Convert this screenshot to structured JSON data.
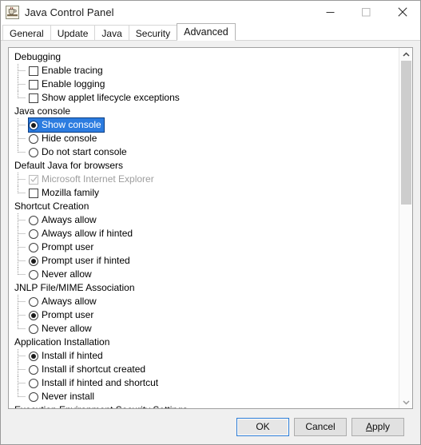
{
  "window": {
    "title": "Java Control Panel",
    "icon": "java-coffee-cup-icon",
    "controls": {
      "minimize": "minimize-icon",
      "maximize": "maximize-icon",
      "close": "close-icon"
    }
  },
  "tabs": [
    {
      "label": "General",
      "active": false
    },
    {
      "label": "Update",
      "active": false
    },
    {
      "label": "Java",
      "active": false
    },
    {
      "label": "Security",
      "active": false
    },
    {
      "label": "Advanced",
      "active": true
    }
  ],
  "tree": [
    {
      "type": "group",
      "label": "Debugging"
    },
    {
      "type": "checkbox",
      "label": "Enable tracing",
      "checked": false,
      "disabled": false,
      "selected": false,
      "last": false
    },
    {
      "type": "checkbox",
      "label": "Enable logging",
      "checked": false,
      "disabled": false,
      "selected": false,
      "last": false
    },
    {
      "type": "checkbox",
      "label": "Show applet lifecycle exceptions",
      "checked": false,
      "disabled": false,
      "selected": false,
      "last": true
    },
    {
      "type": "group",
      "label": "Java console"
    },
    {
      "type": "radio",
      "label": "Show console",
      "checked": true,
      "disabled": false,
      "selected": true,
      "last": false
    },
    {
      "type": "radio",
      "label": "Hide console",
      "checked": false,
      "disabled": false,
      "selected": false,
      "last": false
    },
    {
      "type": "radio",
      "label": "Do not start console",
      "checked": false,
      "disabled": false,
      "selected": false,
      "last": true
    },
    {
      "type": "group",
      "label": "Default Java for browsers"
    },
    {
      "type": "checkbox",
      "label": "Microsoft Internet Explorer",
      "checked": true,
      "disabled": true,
      "selected": false,
      "last": false
    },
    {
      "type": "checkbox",
      "label": "Mozilla family",
      "checked": false,
      "disabled": false,
      "selected": false,
      "last": true
    },
    {
      "type": "group",
      "label": "Shortcut Creation"
    },
    {
      "type": "radio",
      "label": "Always allow",
      "checked": false,
      "disabled": false,
      "selected": false,
      "last": false
    },
    {
      "type": "radio",
      "label": "Always allow if hinted",
      "checked": false,
      "disabled": false,
      "selected": false,
      "last": false
    },
    {
      "type": "radio",
      "label": "Prompt user",
      "checked": false,
      "disabled": false,
      "selected": false,
      "last": false
    },
    {
      "type": "radio",
      "label": "Prompt user if hinted",
      "checked": true,
      "disabled": false,
      "selected": false,
      "last": false
    },
    {
      "type": "radio",
      "label": "Never allow",
      "checked": false,
      "disabled": false,
      "selected": false,
      "last": true
    },
    {
      "type": "group",
      "label": "JNLP File/MIME Association"
    },
    {
      "type": "radio",
      "label": "Always allow",
      "checked": false,
      "disabled": false,
      "selected": false,
      "last": false
    },
    {
      "type": "radio",
      "label": "Prompt user",
      "checked": true,
      "disabled": false,
      "selected": false,
      "last": false
    },
    {
      "type": "radio",
      "label": "Never allow",
      "checked": false,
      "disabled": false,
      "selected": false,
      "last": true
    },
    {
      "type": "group",
      "label": "Application Installation"
    },
    {
      "type": "radio",
      "label": "Install if hinted",
      "checked": true,
      "disabled": false,
      "selected": false,
      "last": false
    },
    {
      "type": "radio",
      "label": "Install if shortcut created",
      "checked": false,
      "disabled": false,
      "selected": false,
      "last": false
    },
    {
      "type": "radio",
      "label": "Install if hinted and shortcut",
      "checked": false,
      "disabled": false,
      "selected": false,
      "last": false
    },
    {
      "type": "radio",
      "label": "Never install",
      "checked": false,
      "disabled": false,
      "selected": false,
      "last": true
    },
    {
      "type": "group",
      "label": "Execution Environment Security Settings"
    }
  ],
  "scrollbar": {
    "up_arrow": "chevron-up-icon",
    "down_arrow": "chevron-down-icon",
    "thumb_position": "top"
  },
  "buttons": {
    "ok": "OK",
    "cancel": "Cancel",
    "apply_prefix": "A",
    "apply_rest": "pply"
  },
  "colors": {
    "selection": "#2c7ce0",
    "selection_border": "#0b3d82",
    "panel_bg": "#f0f0f0",
    "content_bg": "#ffffff",
    "default_button_border": "#2a7ad4",
    "disabled_text": "#9d9d9d",
    "scroll_thumb": "#cdcdcd"
  }
}
